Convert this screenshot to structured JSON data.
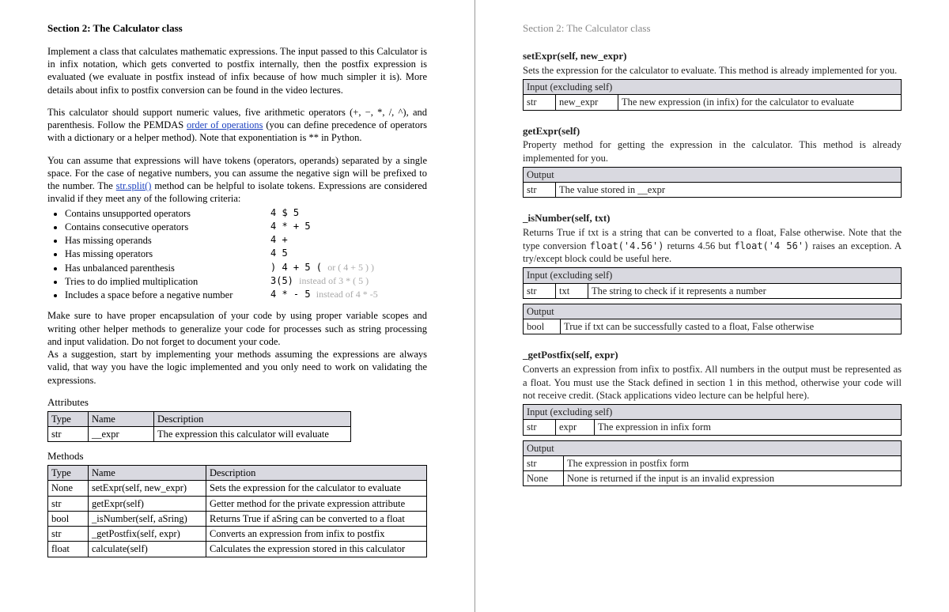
{
  "left": {
    "title": "Section 2: The Calculator class",
    "p1": "Implement a class that calculates mathematic expressions. The input passed to this Calculator is in infix notation, which gets converted to postfix internally, then the postfix expression is evaluated (we evaluate in postfix instead of infix because of how much simpler it is). More details about infix to postfix conversion can be found in the video lectures.",
    "p2a": "This calculator should support numeric values, five arithmetic operators (+, −, *, /, ^), and parenthesis. Follow the PEMDAS ",
    "p2_link": "order of operations",
    "p2b": " (you can define precedence of operators with a dictionary or a helper method). Note that exponentiation is ** in Python.",
    "p3a": "You can assume that expressions will have tokens (operators, operands) separated by a single space. For the case of negative numbers, you can assume the negative sign will be prefixed to the number. The ",
    "p3_link": "str.split()",
    "p3b": " method can be helpful to isolate tokens. Expressions are considered invalid if they meet any of the following criteria:",
    "criteria": [
      {
        "text": "Contains unsupported operators",
        "ex_pre": "4 $ 5",
        "ex_hint": ""
      },
      {
        "text": "Contains consecutive operators",
        "ex_pre": "4 * + 5",
        "ex_hint": ""
      },
      {
        "text": "Has missing operands",
        "ex_pre": "4 +",
        "ex_hint": ""
      },
      {
        "text": "Has missing operators",
        "ex_pre": "4 5",
        "ex_hint": ""
      },
      {
        "text": "Has unbalanced parenthesis",
        "ex_pre": ") 4 + 5 ( ",
        "ex_hint": "or  ( 4 + 5 ) )"
      },
      {
        "text": "Tries to do implied multiplication",
        "ex_pre": "3(5) ",
        "ex_hint": "instead of 3 * ( 5 )"
      },
      {
        "text": "Includes a space before a negative number",
        "ex_pre": "4 * - 5 ",
        "ex_hint": "instead of  4 * -5"
      }
    ],
    "p4": "Make sure to have proper encapsulation of your code by using proper variable scopes and writing other helper methods to generalize your code for processes such as string processing and input validation. Do not forget to document your code.",
    "p5": "As a suggestion, start by implementing your methods assuming the expressions are always valid, that way you have the logic implemented and you only need to work on validating the expressions.",
    "attr_heading": "Attributes",
    "attr_headers": {
      "type": "Type",
      "name": "Name",
      "desc": "Description"
    },
    "attr_rows": [
      {
        "type": "str",
        "name": "__expr",
        "desc": "The expression this calculator will evaluate"
      }
    ],
    "meth_heading": "Methods",
    "meth_headers": {
      "type": "Type",
      "name": "Name",
      "desc": "Description"
    },
    "meth_rows": [
      {
        "type": "None",
        "name": "setExpr(self, new_expr)",
        "desc": "Sets the expression for the calculator to evaluate"
      },
      {
        "type": "str",
        "name": "getExpr(self)",
        "desc": "Getter method for the private expression attribute"
      },
      {
        "type": "bool",
        "name": "_isNumber(self, aSring)",
        "desc": "Returns True if aSring can be converted to a float"
      },
      {
        "type": "str",
        "name": "_getPostfix(self, expr)",
        "desc": "Converts an expression from infix to postfix"
      },
      {
        "type": "float",
        "name": "calculate(self)",
        "desc": "Calculates the expression stored in this calculator"
      }
    ]
  },
  "right": {
    "title": "Section 2: The Calculator class",
    "setExpr": {
      "sig": "setExpr(self, new_expr)",
      "desc": "Sets the expression for the calculator to evaluate. This method is already implemented for you.",
      "in_label": "Input (excluding self)",
      "in_type": "str",
      "in_name": "new_expr",
      "in_desc": "The new expression (in infix) for the calculator to evaluate"
    },
    "getExpr": {
      "sig": "getExpr(self)",
      "desc": "Property method for getting the expression in the calculator. This method is already implemented for you.",
      "out_label": "Output",
      "out_type": "str",
      "out_desc": "The value stored in __expr"
    },
    "isNumber": {
      "sig": "_isNumber(self, txt)",
      "desc_a": "Returns True if txt is a string that can be converted to a float, False otherwise. Note that the type conversion ",
      "code1": "float('4.56')",
      "mid1": " returns 4.56 but ",
      "code2": "float('4   56')",
      "desc_b": " raises an exception. A try/except block could be useful here.",
      "in_label": "Input (excluding self)",
      "in_type": "str",
      "in_name": "txt",
      "in_desc": "The string to check if it represents a number",
      "out_label": "Output",
      "out_type": "bool",
      "out_desc": "True if txt can be successfully casted to a float, False otherwise"
    },
    "getPostfix": {
      "sig": "_getPostfix(self, expr)",
      "desc": "Converts an expression from infix to postfix. All numbers in the output must be represented as a float. You must use the Stack defined in section 1 in this method, otherwise your code will not receive credit. (Stack applications video lecture can be helpful here).",
      "in_label": "Input (excluding self)",
      "in_type": "str",
      "in_name": "expr",
      "in_desc": "The expression in infix form",
      "out_label": "Output",
      "out1_type": "str",
      "out1_desc": "The expression in postfix form",
      "out2_type": "None",
      "out2_desc": "None is returned if the input is an invalid expression"
    }
  }
}
